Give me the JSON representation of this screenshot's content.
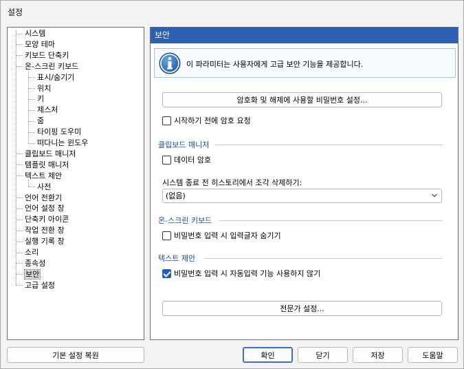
{
  "window": {
    "title": "설정"
  },
  "tree": {
    "items": [
      {
        "label": "시스템",
        "level": 0
      },
      {
        "label": "모양 테마",
        "level": 0
      },
      {
        "label": "키보드 단축키",
        "level": 0
      },
      {
        "label": "온-스크린 키보드",
        "level": 0
      },
      {
        "label": "표시/숨기기",
        "level": 1
      },
      {
        "label": "위치",
        "level": 1
      },
      {
        "label": "키",
        "level": 1
      },
      {
        "label": "제스처",
        "level": 1
      },
      {
        "label": "줌",
        "level": 1
      },
      {
        "label": "타이핑 도우미",
        "level": 1
      },
      {
        "label": "떠다니는 윈도우",
        "level": 1
      },
      {
        "label": "클립보드 매니저",
        "level": 0
      },
      {
        "label": "템플릿 매니저",
        "level": 0
      },
      {
        "label": "텍스트 제안",
        "level": 0
      },
      {
        "label": "사전",
        "level": 1
      },
      {
        "label": "언어 전환기",
        "level": 0
      },
      {
        "label": "언어 설정 창",
        "level": 0
      },
      {
        "label": "단축키 아이콘",
        "level": 0
      },
      {
        "label": "작업 전환 창",
        "level": 0
      },
      {
        "label": "실행 기록 창",
        "level": 0
      },
      {
        "label": "소리",
        "level": 0
      },
      {
        "label": "종속성",
        "level": 0
      },
      {
        "label": "보안",
        "level": 0,
        "selected": true
      },
      {
        "label": "고급 설정",
        "level": 0
      }
    ]
  },
  "panel": {
    "header": "보안",
    "info_text": "이 파라미터는 사용자에게 고급 보안 기능을 제공합니다.",
    "set_password_button": "암호화 및 해제에 사용할 비밀번호 설정...",
    "require_password_on_start": {
      "label": "시작하기 전에 암호 요청",
      "checked": false
    },
    "clipboard_section": "클립보드 매니저",
    "encrypt_data": {
      "label": "데이터 암호",
      "checked": false
    },
    "history_delete_label": "시스템 종료 전 히스토리에서 조각 삭제하기:",
    "history_delete_value": "(없음)",
    "osk_section": "온-스크린 키보드",
    "hide_password_chars": {
      "label": "비밀번호 입력 시 입력글자 숨기기",
      "checked": false
    },
    "text_suggest_section": "텍스트 제안",
    "no_autocomplete_password": {
      "label": "비밀번호 입력 시 자동입력 기능 사용하지 않기",
      "checked": true
    },
    "expert_settings_button": "전문가 설정..."
  },
  "footer": {
    "restore_defaults": "기본 설정 복원",
    "ok": "확인",
    "close": "닫기",
    "save": "저장",
    "help": "도움말"
  },
  "colors": {
    "header_bg": "#2e5fb3",
    "section_title": "#1d4d99",
    "checkbox_checked": "#1f5fbf"
  }
}
